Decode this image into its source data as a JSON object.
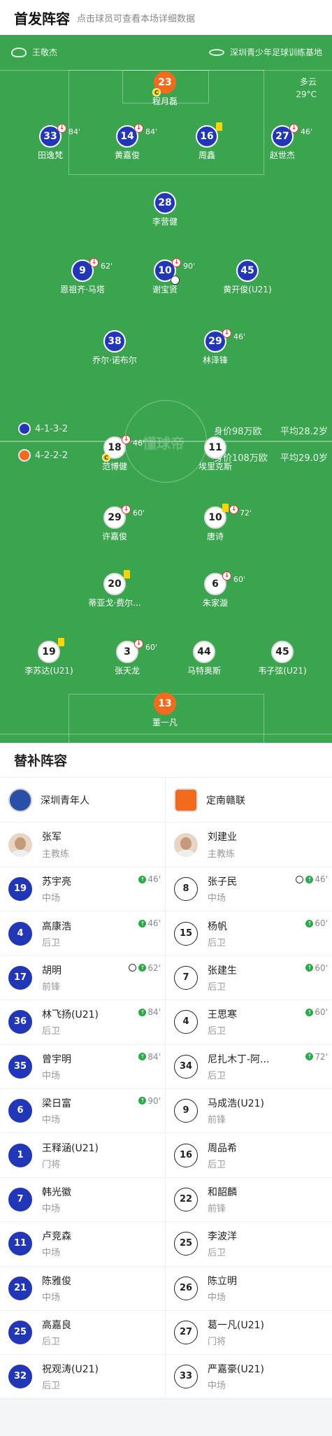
{
  "header": {
    "title": "首发阵容",
    "subtitle": "点击球员可查看本场详细数据"
  },
  "match": {
    "referee": "王敬杰",
    "venue": "深圳青少年足球训练基地",
    "weather": "多云",
    "temperature": "29°C"
  },
  "watermark": "懂球帝",
  "home_team": {
    "formation": "4-1-3-2",
    "value": "身价98万欧",
    "avg_age": "平均28.2岁"
  },
  "away_team": {
    "formation": "4-2-2-2",
    "value": "身价108万欧",
    "avg_age": "平均29.0岁"
  },
  "home_players": [
    {
      "num": "23",
      "name": "程月磊",
      "color": "orange",
      "captain": true
    },
    {
      "num": "33",
      "name": "田逸梵",
      "sub": "84'"
    },
    {
      "num": "14",
      "name": "黄嘉俊",
      "sub": "84'"
    },
    {
      "num": "16",
      "name": "周鑫",
      "yellow": true
    },
    {
      "num": "27",
      "name": "赵世杰",
      "sub": "46'"
    },
    {
      "num": "28",
      "name": "李营健"
    },
    {
      "num": "9",
      "name": "恩祖齐·马塔",
      "sub": "62'"
    },
    {
      "num": "10",
      "name": "谢宝贤",
      "sub": "90'",
      "goal": true
    },
    {
      "num": "45",
      "name": "黄开俊(U21)"
    },
    {
      "num": "38",
      "name": "乔尔·诺布尔"
    },
    {
      "num": "29",
      "name": "林泽锋",
      "sub": "46'"
    }
  ],
  "away_players": [
    {
      "num": "18",
      "name": "范博健",
      "sub": "46'",
      "captain": true
    },
    {
      "num": "11",
      "name": "埃里克斯"
    },
    {
      "num": "29",
      "name": "许嘉俊",
      "sub": "60'"
    },
    {
      "num": "10",
      "name": "唐诗",
      "yellow": true,
      "sub": "72'"
    },
    {
      "num": "20",
      "name": "蒂亚戈·费尔...",
      "yellow": true
    },
    {
      "num": "6",
      "name": "朱家漩",
      "sub": "60'"
    },
    {
      "num": "19",
      "name": "李苏达(U21)",
      "yellow": true
    },
    {
      "num": "3",
      "name": "张天龙",
      "sub": "60'"
    },
    {
      "num": "44",
      "name": "马特奥斯"
    },
    {
      "num": "45",
      "name": "韦子弦(U21)"
    },
    {
      "num": "13",
      "name": "董一凡",
      "color": "orange"
    }
  ],
  "bench": {
    "title": "替补阵容",
    "home": {
      "team": "深圳青年人",
      "coach": "张军",
      "coach_role": "主教练",
      "subs": [
        {
          "num": "19",
          "name": "苏宇亮",
          "pos": "中场",
          "in": "46'"
        },
        {
          "num": "4",
          "name": "高康浩",
          "pos": "后卫",
          "in": "46'"
        },
        {
          "num": "17",
          "name": "胡明",
          "pos": "前锋",
          "in": "62'",
          "goal": true
        },
        {
          "num": "36",
          "name": "林飞扬(U21)",
          "pos": "后卫",
          "in": "84'"
        },
        {
          "num": "35",
          "name": "曾宇明",
          "pos": "中场",
          "in": "84'"
        },
        {
          "num": "6",
          "name": "梁日富",
          "pos": "中场",
          "in": "90'"
        },
        {
          "num": "1",
          "name": "王释涵(U21)",
          "pos": "门将"
        },
        {
          "num": "7",
          "name": "韩光徽",
          "pos": "中场"
        },
        {
          "num": "11",
          "name": "卢竞森",
          "pos": "中场"
        },
        {
          "num": "21",
          "name": "陈雅俊",
          "pos": "中场"
        },
        {
          "num": "25",
          "name": "高嘉良",
          "pos": "后卫"
        },
        {
          "num": "32",
          "name": "祝观涛(U21)",
          "pos": "后卫"
        }
      ]
    },
    "away": {
      "team": "定南赣联",
      "coach": "刘建业",
      "coach_role": "主教练",
      "subs": [
        {
          "num": "8",
          "name": "张子民",
          "pos": "中场",
          "in": "46'",
          "goal": true
        },
        {
          "num": "15",
          "name": "杨帆",
          "pos": "后卫",
          "in": "60'"
        },
        {
          "num": "7",
          "name": "张建生",
          "pos": "后卫",
          "in": "60'"
        },
        {
          "num": "4",
          "name": "王思寒",
          "pos": "后卫",
          "in": "60'"
        },
        {
          "num": "34",
          "name": "尼扎木丁-阿...",
          "pos": "后卫",
          "in": "72'"
        },
        {
          "num": "9",
          "name": "马成浩(U21)",
          "pos": "前锋"
        },
        {
          "num": "16",
          "name": "周品希",
          "pos": "后卫"
        },
        {
          "num": "22",
          "name": "和韶麟",
          "pos": "前锋"
        },
        {
          "num": "25",
          "name": "李波洋",
          "pos": "后卫"
        },
        {
          "num": "26",
          "name": "陈立明",
          "pos": "中场"
        },
        {
          "num": "27",
          "name": "葛一凡(U21)",
          "pos": "门将"
        },
        {
          "num": "33",
          "name": "严嘉豪(U21)",
          "pos": "中场"
        }
      ]
    }
  }
}
